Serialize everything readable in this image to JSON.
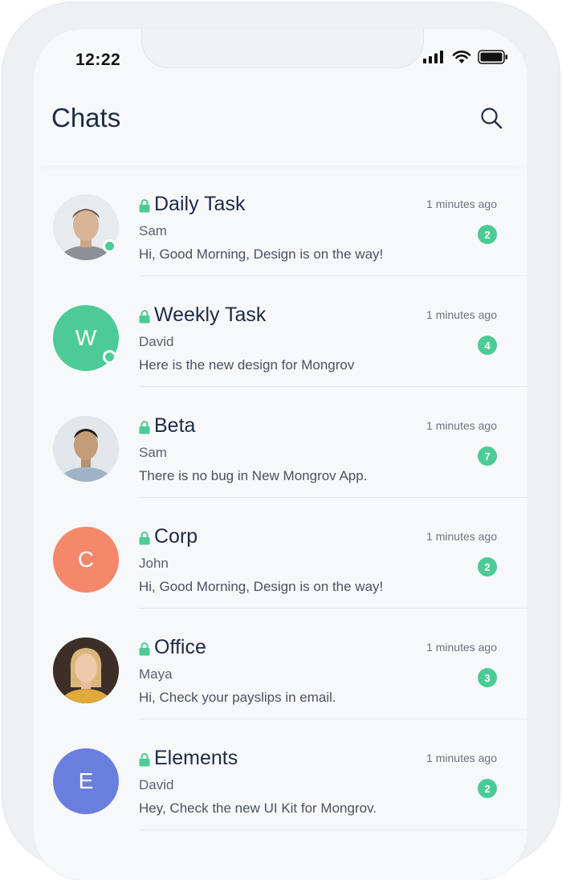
{
  "status_bar": {
    "time": "12:22",
    "icons": [
      "signal-icon",
      "wifi-icon",
      "battery-icon"
    ]
  },
  "header": {
    "title": "Chats",
    "search_icon": "search-icon"
  },
  "colors": {
    "accent": "#4ccb96",
    "title_text": "#1e2a45",
    "avatar_green": "#4ccb96",
    "avatar_orange": "#f5876a",
    "avatar_blue": "#6a7fdd"
  },
  "chats": [
    {
      "title": "Daily Task",
      "time": "1 minutes ago",
      "sender": "Sam",
      "message": "Hi, Good Morning, Design is on the way!",
      "unread": "2",
      "avatar_type": "photo",
      "online": true
    },
    {
      "title": "Weekly Task",
      "time": "1 minutes ago",
      "sender": "David",
      "message": "Here is the new design for Mongrov",
      "unread": "4",
      "avatar_type": "initial",
      "avatar_initial": "W",
      "avatar_color": "#4ccb96",
      "online": true
    },
    {
      "title": "Beta",
      "time": "1 minutes ago",
      "sender": "Sam",
      "message": "There is no bug in New Mongrov App.",
      "unread": "7",
      "avatar_type": "photo",
      "online": false
    },
    {
      "title": "Corp",
      "time": "1 minutes ago",
      "sender": "John",
      "message": "Hi, Good Morning, Design is on the way!",
      "unread": "2",
      "avatar_type": "initial",
      "avatar_initial": "C",
      "avatar_color": "#f5876a",
      "online": false
    },
    {
      "title": "Office",
      "time": "1 minutes ago",
      "sender": "Maya",
      "message": "Hi, Check your payslips in email.",
      "unread": "3",
      "avatar_type": "photo",
      "online": false
    },
    {
      "title": "Elements",
      "time": "1 minutes ago",
      "sender": "David",
      "message": "Hey, Check the new UI Kit for Mongrov.",
      "unread": "2",
      "avatar_type": "initial",
      "avatar_initial": "E",
      "avatar_color": "#6a7fdd",
      "online": false
    }
  ]
}
